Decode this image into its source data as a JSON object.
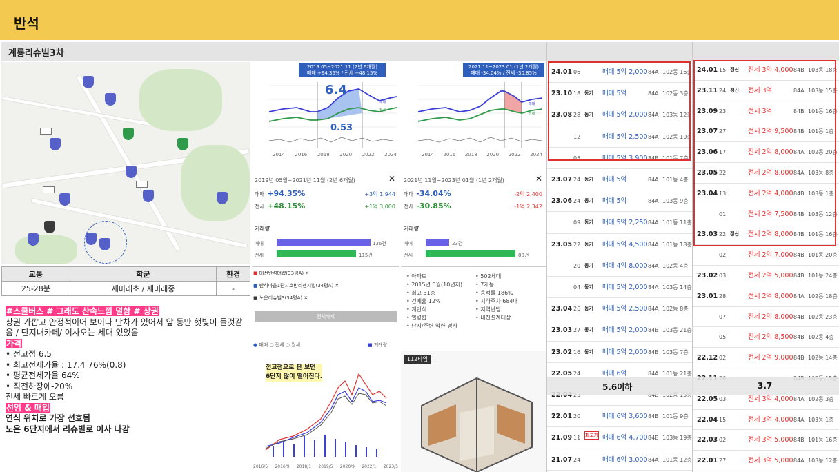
{
  "header": {
    "title": "반석"
  },
  "complex_name": "계룡리슈빌3차",
  "chart1": {
    "tag_line1": "2019.05~2021.11 (2년 6개월)",
    "tag_line2": "매매 +94.35% / 전세 +48.15%",
    "big_value": "6.4",
    "small_value": "0.53",
    "period": "2019년 05월~2021년 11월 (2년 6개월)",
    "sale_label": "매매",
    "sale_pct": "+94.35%",
    "sale_amt": "+3억 1,944",
    "jeonse_label": "전세",
    "jeonse_pct": "+48.15%",
    "jeonse_amt": "+1억 3,000",
    "vol_title": "거래량",
    "vol_sale": "136건",
    "vol_jeonse": "115건",
    "years": [
      "2014",
      "2016",
      "2018",
      "2020",
      "2022",
      "2024"
    ]
  },
  "chart2": {
    "tag_line1": "2021.11~2023.01 (1년 2개월)",
    "tag_line2": "매매 -34.04% / 전세 -30.85%",
    "period": "2021년 11월~2023년 01월 (1년 2개월)",
    "sale_label": "매매",
    "sale_pct": "-34.04%",
    "sale_amt": "-2억 2,400",
    "jeonse_label": "전세",
    "jeonse_pct": "-30.85%",
    "jeonse_amt": "-1억 2,342",
    "vol_title": "거래량",
    "vol_sale": "23건",
    "vol_jeonse": "88건",
    "years": [
      "2014",
      "2016",
      "2018",
      "2020",
      "2022",
      "2024"
    ]
  },
  "compare": {
    "items": [
      "대전반석더샵(33평A)",
      "반석마을1단지호반리젠시빌(34평A)",
      "노은리슈빌3(34평A)"
    ],
    "delete_all": "전체삭제",
    "legend": [
      "매매",
      "전세",
      "월세"
    ],
    "volume_legend": "거래량",
    "note_line1": "전고점으로 판 보면",
    "note_line2": "6단지 많이 떨어진다.",
    "dates": [
      "2016/5",
      "2016/9",
      "2018/1",
      "2019/5",
      "2020/9",
      "2022/1",
      "2023/5"
    ]
  },
  "info": {
    "left": [
      "아파트",
      "2015년 5월(10년차)",
      "최고 31층",
      "건폐율 12%",
      "계단식",
      "열병합",
      "단지/주변 약한 경사"
    ],
    "right": [
      "502세대",
      "7개동",
      "용적률 186%",
      "지하주차 684대",
      "지역난방",
      "내진설계대상"
    ]
  },
  "floorplan": {
    "label": "112타입"
  },
  "table": {
    "headers": [
      "교통",
      "학군",
      "환경"
    ],
    "values": [
      "25-28분",
      "새미래초 / 새미래중",
      "-"
    ]
  },
  "notes": {
    "tags": "#스쿨버스 # 그래도 산속느낌 덜함 # 상권",
    "desc": "상권 가깝고 안정적이어 보이나 단차가 있어서 앞 동만 햇빛이 들것같음 / 단지내카페/ 이사오는 세대 있었음",
    "price_title": "가격",
    "bullets": [
      "전고점 6.5",
      "최고전세가율 : 17.4 76%(0.8)",
      "평균전세가율 64%",
      "직전하장에-20%"
    ],
    "fast": "전세 빠르게 오름",
    "pref_title": "선임 & 매입",
    "pref1": "연식 위치로 가장 선호됨",
    "pref2": "노은 6단지에서 리슈빌로 이사 나감"
  },
  "sales": [
    {
      "ym": "24.01",
      "d": "06",
      "tag": "",
      "price": "매매 5억 2,000",
      "area": "84A",
      "loc": "102동 16층"
    },
    {
      "ym": "23.10",
      "d": "18",
      "tag": "동기",
      "price": "매매 5억",
      "area": "84A",
      "loc": "102동 3층"
    },
    {
      "ym": "23.08",
      "d": "28",
      "tag": "동기",
      "price": "매매 5억 2,000",
      "area": "84A",
      "loc": "103동 12층"
    },
    {
      "ym": "",
      "d": "12",
      "tag": "",
      "price": "매매 5억 2,500",
      "area": "84A",
      "loc": "102동 10층"
    },
    {
      "ym": "",
      "d": "05",
      "tag": "",
      "price": "매매 5억 3,900",
      "area": "84B",
      "loc": "101동 7층"
    },
    {
      "ym": "23.07",
      "d": "24",
      "tag": "동기",
      "price": "매매 5억",
      "area": "84A",
      "loc": "101동 4층"
    },
    {
      "ym": "23.06",
      "d": "24",
      "tag": "동기",
      "price": "매매 5억",
      "area": "84A",
      "loc": "103동 9층"
    },
    {
      "ym": "",
      "d": "09",
      "tag": "동기",
      "price": "매매 5억 2,250",
      "area": "84A",
      "loc": "101동 11층"
    },
    {
      "ym": "23.05",
      "d": "22",
      "tag": "동기",
      "price": "매매 5억 4,500",
      "area": "84A",
      "loc": "101동 18층"
    },
    {
      "ym": "",
      "d": "20",
      "tag": "동기",
      "price": "매매 4억 8,000",
      "area": "84A",
      "loc": "102동 4층"
    },
    {
      "ym": "",
      "d": "04",
      "tag": "동기",
      "price": "매매 5억 2,000",
      "area": "84A",
      "loc": "103동 14층"
    },
    {
      "ym": "23.04",
      "d": "26",
      "tag": "동기",
      "price": "매매 5억 2,500",
      "area": "84A",
      "loc": "102동 8층"
    },
    {
      "ym": "23.03",
      "d": "27",
      "tag": "동기",
      "price": "매매 5억 2,000",
      "area": "84B",
      "loc": "103동 21층"
    },
    {
      "ym": "23.02",
      "d": "16",
      "tag": "동기",
      "price": "매매 5억 2,000",
      "area": "84B",
      "loc": "103동 7층"
    },
    {
      "ym": "22.05",
      "d": "24",
      "tag": "",
      "price": "매매 6억",
      "area": "84A",
      "loc": "101동 21층"
    },
    {
      "ym": "22.04",
      "d": "23",
      "tag": "",
      "price": "",
      "area": "84B",
      "loc": "102동 15층"
    },
    {
      "ym": "22.01",
      "d": "20",
      "tag": "",
      "price": "매매 6억 3,600",
      "area": "84B",
      "loc": "101동 9층"
    },
    {
      "ym": "21.09",
      "d": "11",
      "tag": "최고가",
      "price": "매매 6억 4,700",
      "area": "84B",
      "loc": "103동 19층"
    },
    {
      "ym": "21.07",
      "d": "24",
      "tag": "",
      "price": "매매 6억 3,000",
      "area": "84A",
      "loc": "101동 12층"
    }
  ],
  "sales_mid_label": "5.6이하",
  "jeonse": [
    {
      "ym": "24.01",
      "d": "15",
      "tag": "갱신",
      "price": "전세 3억 4,000",
      "area": "84B",
      "loc": "103동 18층"
    },
    {
      "ym": "23.11",
      "d": "24",
      "tag": "갱신",
      "price": "전세 3억",
      "area": "84A",
      "loc": "103동 15층"
    },
    {
      "ym": "23.09",
      "d": "23",
      "tag": "",
      "price": "전세 3억",
      "area": "84B",
      "loc": "101동 16층"
    },
    {
      "ym": "23.07",
      "d": "27",
      "tag": "",
      "price": "전세 2억 9,500",
      "area": "84B",
      "loc": "101동 1층"
    },
    {
      "ym": "23.06",
      "d": "17",
      "tag": "",
      "price": "전세 2억 8,000",
      "area": "84A",
      "loc": "102동 20층"
    },
    {
      "ym": "23.05",
      "d": "22",
      "tag": "",
      "price": "전세 2억 8,000",
      "area": "84A",
      "loc": "103동 8층"
    },
    {
      "ym": "23.04",
      "d": "13",
      "tag": "",
      "price": "전세 2억 4,000",
      "area": "84B",
      "loc": "103동 1층"
    },
    {
      "ym": "",
      "d": "01",
      "tag": "",
      "price": "전세 2억 7,500",
      "area": "84B",
      "loc": "103동 12층"
    },
    {
      "ym": "23.03",
      "d": "22",
      "tag": "갱신",
      "price": "전세 2억 8,000",
      "area": "84B",
      "loc": "101동 16층"
    },
    {
      "ym": "",
      "d": "02",
      "tag": "",
      "price": "전세 2억 7,000",
      "area": "84B",
      "loc": "101동 20층"
    },
    {
      "ym": "23.02",
      "d": "03",
      "tag": "",
      "price": "전세 2억 5,000",
      "area": "84B",
      "loc": "101동 24층"
    },
    {
      "ym": "23.01",
      "d": "28",
      "tag": "",
      "price": "전세 2억 8,000",
      "area": "84A",
      "loc": "102동 18층"
    },
    {
      "ym": "",
      "d": "07",
      "tag": "",
      "price": "전세 2억 8,000",
      "area": "84B",
      "loc": "102동 23층"
    },
    {
      "ym": "",
      "d": "05",
      "tag": "",
      "price": "전세 2억 8,500",
      "area": "84B",
      "loc": "102동 4층"
    },
    {
      "ym": "22.12",
      "d": "02",
      "tag": "",
      "price": "전세 2억 9,000",
      "area": "84B",
      "loc": "102동 14층"
    },
    {
      "ym": "22.11",
      "d": "26",
      "tag": "",
      "price": "",
      "area": "84B",
      "loc": "102동 15층"
    },
    {
      "ym": "22.05",
      "d": "03",
      "tag": "",
      "price": "전세 3억 4,000",
      "area": "84A",
      "loc": "102동 3층"
    },
    {
      "ym": "22.04",
      "d": "15",
      "tag": "",
      "price": "전세 3억 4,000",
      "area": "84A",
      "loc": "103동 1층"
    },
    {
      "ym": "22.03",
      "d": "02",
      "tag": "",
      "price": "전세 3억 5,000",
      "area": "84B",
      "loc": "101동 16층"
    },
    {
      "ym": "22.01",
      "d": "27",
      "tag": "",
      "price": "전세 3억 5,000",
      "area": "84A",
      "loc": "103동 12층"
    }
  ],
  "jeonse_mid_label": "3.7"
}
